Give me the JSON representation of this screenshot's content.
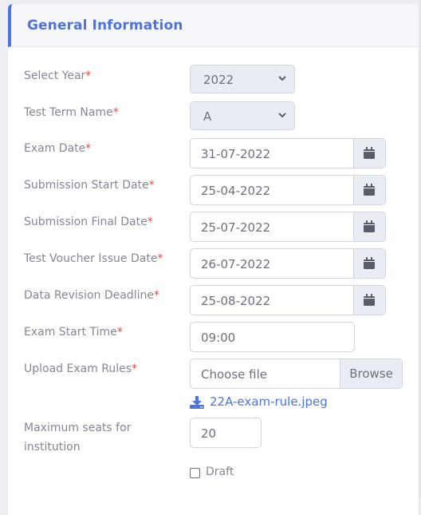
{
  "card": {
    "title": "General Information",
    "accent_color": "#4e73df"
  },
  "fields": {
    "year": {
      "label": "Select Year",
      "required_mark": "*",
      "value": "2022"
    },
    "term": {
      "label": "Test Term Name",
      "required_mark": "*",
      "value": "A"
    },
    "exam_date": {
      "label": "Exam Date",
      "required_mark": "*",
      "value": "31-07-2022"
    },
    "submission_start": {
      "label": "Submission Start Date",
      "required_mark": "*",
      "value": "25-04-2022"
    },
    "submission_final": {
      "label": "Submission Final Date",
      "required_mark": "*",
      "value": "25-07-2022"
    },
    "voucher_issue": {
      "label": "Test Voucher Issue Date",
      "required_mark": "*",
      "value": "26-07-2022"
    },
    "data_revision": {
      "label": "Data Revision Deadline",
      "required_mark": "*",
      "value": "25-08-2022"
    },
    "exam_start_time": {
      "label": "Exam Start Time",
      "required_mark": "*",
      "value": "09:00"
    },
    "exam_rules": {
      "label": "Upload Exam Rules",
      "required_mark": "*",
      "placeholder": "Choose file",
      "browse_label": "Browse",
      "file_name": "22A-exam-rule.jpeg"
    },
    "max_seats": {
      "label_line1": "Maximum seats for",
      "label_line2": "institution",
      "value": "20"
    },
    "draft": {
      "label": "Draft",
      "checked": false
    }
  }
}
